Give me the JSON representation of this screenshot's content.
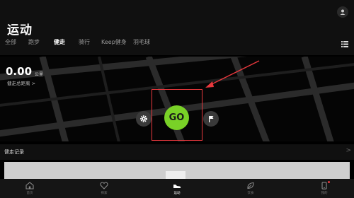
{
  "header": {
    "title": "运动"
  },
  "tabs": [
    {
      "label": "全部",
      "active": false
    },
    {
      "label": "跑步",
      "active": false
    },
    {
      "label": "健走",
      "active": true
    },
    {
      "label": "骑行",
      "active": false
    },
    {
      "label": "Keep健身",
      "active": false
    },
    {
      "label": "羽毛球",
      "active": false
    }
  ],
  "distance": {
    "value": "0.00",
    "unit": "公里",
    "link": "健走总距离 >"
  },
  "start_button": {
    "label": "GO"
  },
  "records": {
    "label": "健走记录",
    "chevron": ">"
  },
  "bottom_nav": [
    {
      "label": "首页",
      "icon": "home-icon"
    },
    {
      "label": "探索",
      "icon": "heart-icon"
    },
    {
      "label": "运动",
      "icon": "shoe-icon",
      "active": true
    },
    {
      "label": "饮食",
      "icon": "leaf-icon"
    },
    {
      "label": "我的",
      "icon": "phone-icon",
      "badge": true
    }
  ],
  "colors": {
    "accent_green": "#79d127",
    "annotation_red": "#e8383d",
    "background": "#000000"
  }
}
